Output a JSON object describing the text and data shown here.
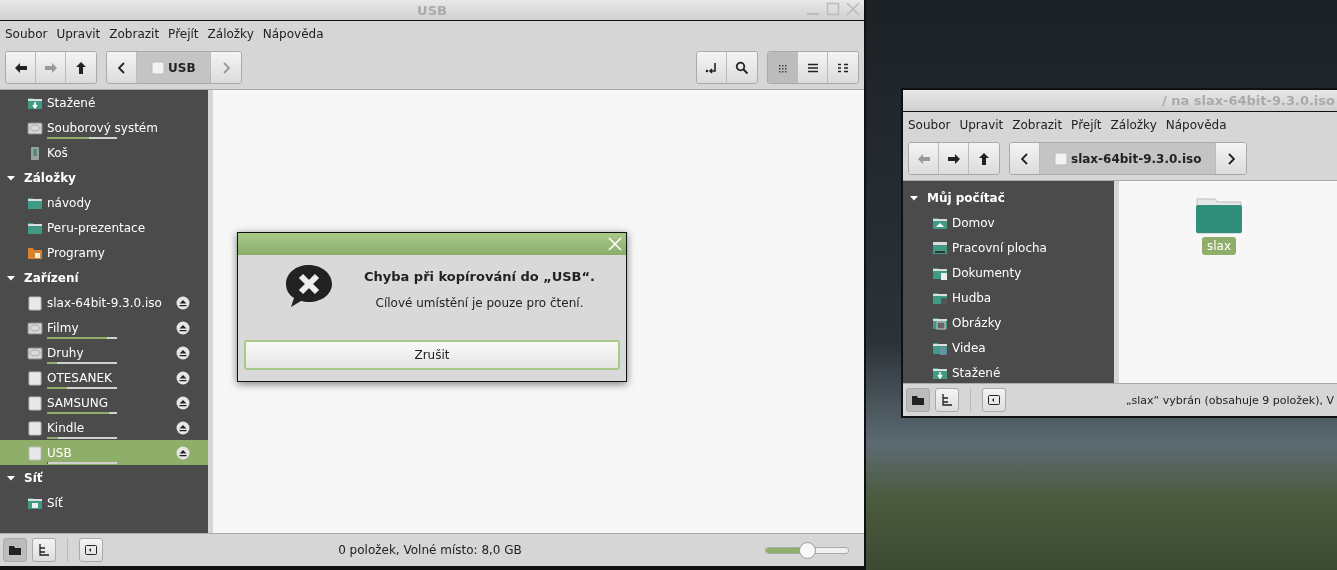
{
  "main_window": {
    "title": "USB",
    "menu": [
      "Soubor",
      "Upravit",
      "Zobrazit",
      "Přejít",
      "Záložky",
      "Nápověda"
    ],
    "nav_buttons": [
      {
        "kind": "back",
        "disabled": false
      },
      {
        "kind": "forward",
        "disabled": true
      },
      {
        "kind": "up",
        "disabled": false
      }
    ],
    "path_bar": {
      "prev_disabled": false,
      "next_disabled": true,
      "crumb": "USB"
    },
    "tool_buttons": [
      {
        "kind": "terminal"
      },
      {
        "kind": "search"
      }
    ],
    "view_buttons": [
      {
        "kind": "icons",
        "selected": true
      },
      {
        "kind": "list",
        "selected": false
      },
      {
        "kind": "compact",
        "selected": false
      }
    ],
    "sidebar": {
      "items_above": [
        {
          "label": "Stažené",
          "kind": "download",
          "selected": false
        },
        {
          "label": "Souborový systém",
          "kind": "drive",
          "selected": false,
          "level": 0.6
        },
        {
          "label": "Koš",
          "kind": "trash",
          "selected": false
        }
      ],
      "sections": [
        {
          "title": "Záložky",
          "expanded": true,
          "items": [
            {
              "label": "návody",
              "kind": "folder",
              "selected": false
            },
            {
              "label": "Peru-prezentace",
              "kind": "folder",
              "selected": false
            },
            {
              "label": "Programy",
              "kind": "app",
              "selected": false
            }
          ]
        },
        {
          "title": "Zařízení",
          "expanded": true,
          "items": [
            {
              "label": "slax-64bit-9.3.0.iso",
              "kind": "device",
              "selected": false,
              "eject": true
            },
            {
              "label": "Filmy",
              "kind": "drive",
              "selected": false,
              "eject": true,
              "level": 0.86
            },
            {
              "label": "Druhy",
              "kind": "drive",
              "selected": false,
              "eject": true,
              "level": 0.14
            },
            {
              "label": "OTESANEK",
              "kind": "device",
              "selected": false,
              "eject": true,
              "level": 0.29
            },
            {
              "label": "SAMSUNG",
              "kind": "device",
              "selected": false,
              "eject": true,
              "level": 0.89
            },
            {
              "label": "Kindle",
              "kind": "device",
              "selected": false,
              "eject": true,
              "level": 0.16
            },
            {
              "label": "USB",
              "kind": "device",
              "selected": true,
              "eject": true,
              "level": 0.02
            }
          ]
        },
        {
          "title": "Síť",
          "expanded": true,
          "items": [
            {
              "label": "Síť",
              "kind": "network",
              "selected": false
            }
          ]
        }
      ]
    },
    "status_buttons": [
      {
        "kind": "places",
        "selected": true
      },
      {
        "kind": "tree",
        "selected": false
      },
      {
        "kind": "sidebar",
        "selected": false
      }
    ],
    "status_text": "0 položek, Volné místo: 8,0 GB",
    "zoom_slider": {
      "level": 0.5
    }
  },
  "dialog": {
    "heading": "Chyba při kopírování do „USB“.",
    "message": "Cílové umístění je pouze pro čtení.",
    "button": "Zrušit"
  },
  "second_window": {
    "title": "/ na slax-64bit-9.3.0.iso",
    "menu": [
      "Soubor",
      "Upravit",
      "Zobrazit",
      "Přejít",
      "Záložky",
      "Nápověda"
    ],
    "nav_buttons": [
      {
        "kind": "back",
        "disabled": true
      },
      {
        "kind": "forward",
        "disabled": false
      },
      {
        "kind": "up",
        "disabled": false
      }
    ],
    "path_bar": {
      "prev_disabled": false,
      "next_disabled": false,
      "crumb": "slax-64bit-9.3.0.iso"
    },
    "sidebar": {
      "sections": [
        {
          "title": "Můj počítač",
          "expanded": true,
          "items": [
            {
              "label": "Domov",
              "kind": "home",
              "selected": false
            },
            {
              "label": "Pracovní plocha",
              "kind": "desktop",
              "selected": false
            },
            {
              "label": "Dokumenty",
              "kind": "documents",
              "selected": false
            },
            {
              "label": "Hudba",
              "kind": "music",
              "selected": false
            },
            {
              "label": "Obrázky",
              "kind": "pictures",
              "selected": false
            },
            {
              "label": "Videa",
              "kind": "videos",
              "selected": false
            },
            {
              "label": "Stažené",
              "kind": "download",
              "selected": false
            }
          ]
        }
      ]
    },
    "files": [
      {
        "name": "slax",
        "selected": true
      }
    ],
    "status_buttons": [
      {
        "kind": "places",
        "selected": true
      },
      {
        "kind": "tree",
        "selected": false
      },
      {
        "kind": "sidebar",
        "selected": false
      }
    ],
    "status_text": "„slax“ vybrán (obsahuje 9 položek), V"
  }
}
